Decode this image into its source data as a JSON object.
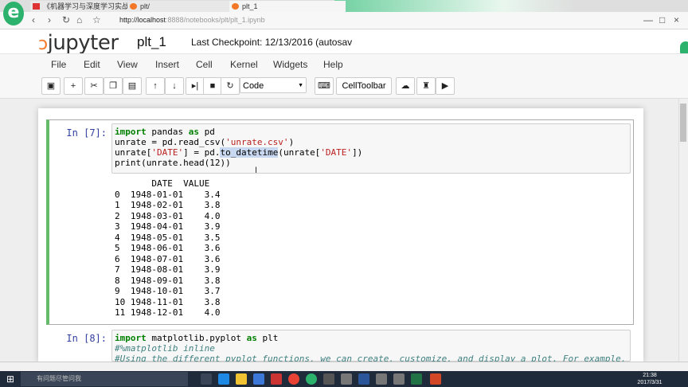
{
  "browser": {
    "tabs": [
      {
        "label": "《机器学习与深度学习实战》直接"
      },
      {
        "label": "plt/"
      },
      {
        "label": "plt_1"
      }
    ],
    "url_host": "http://localhost",
    "url_rest": ":8888/notebooks/plt/plt_1.ipynb"
  },
  "jupyter": {
    "logo": "jupyter",
    "notebook_name": "plt_1",
    "checkpoint": "Last Checkpoint: 12/13/2016 (autosav"
  },
  "menu": [
    "File",
    "Edit",
    "View",
    "Insert",
    "Cell",
    "Kernel",
    "Widgets",
    "Help"
  ],
  "toolbar": {
    "cell_type": "Code",
    "cell_toolbar": "CellToolbar"
  },
  "cells": [
    {
      "prompt": "In [7]:",
      "code": [
        [
          "import",
          " pandas ",
          "as",
          " pd"
        ],
        "unrate = pd.read_csv('unrate.csv')",
        "unrate['DATE'] = pd.to_datetime(unrate['DATE'])",
        "print(unrate.head(12))"
      ],
      "output_header": "       DATE  VALUE",
      "output_rows": [
        "0  1948-01-01    3.4",
        "1  1948-02-01    3.8",
        "2  1948-03-01    4.0",
        "3  1948-04-01    3.9",
        "4  1948-05-01    3.5",
        "5  1948-06-01    3.6",
        "6  1948-07-01    3.6",
        "7  1948-08-01    3.9",
        "8  1948-09-01    3.8",
        "9  1948-10-01    3.7",
        "10 1948-11-01    3.8",
        "11 1948-12-01    4.0"
      ]
    },
    {
      "prompt": "In [8]:",
      "line1_kw1": "import",
      "line1_mid": " matplotlib.pyplot ",
      "line1_kw2": "as",
      "line1_end": " plt",
      "line2": "#%matplotlib inline",
      "line3": "#Using the different pyplot functions, we can create, customize, and display a plot. For example, we can use"
    }
  ],
  "taskbar": {
    "search_placeholder": "有问题尽管问我",
    "time": "21:38",
    "date": "2017/3/31"
  },
  "colors": {
    "cell_selected_border": "#66bb6a",
    "prompt": "#303f9f",
    "keyword": "#008000",
    "string": "#ba2121",
    "jupyter_orange": "#f37726"
  }
}
